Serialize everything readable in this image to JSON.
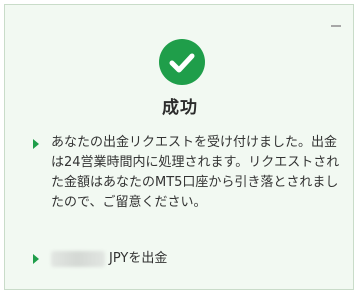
{
  "dialog": {
    "title": "成功",
    "message": "あなたの出金リクエストを受け付けました。出金は24営業時間内に処理されます。リクエストされた金額はあなたのMT5口座から引き落とされましたので、ご留意ください。",
    "amount_suffix": "JPYを出金",
    "colors": {
      "accent": "#1f9e4a",
      "background": "#f2f9f2"
    },
    "icons": {
      "status": "check-circle-icon",
      "bullet": "triangle-right-icon",
      "window": "minimize-icon"
    }
  }
}
